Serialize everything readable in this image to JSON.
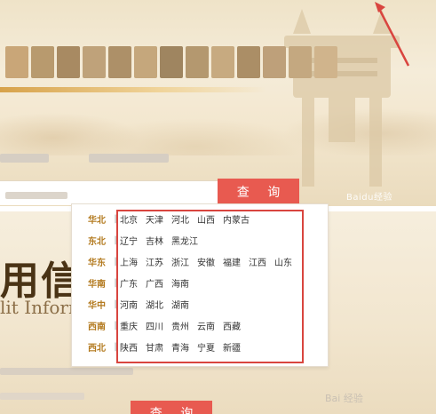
{
  "search": {
    "query_button_label": "查 询"
  },
  "dropdown": {
    "regions": [
      {
        "name": "华北",
        "provinces": [
          "北京",
          "天津",
          "河北",
          "山西",
          "内蒙古"
        ]
      },
      {
        "name": "东北",
        "provinces": [
          "辽宁",
          "吉林",
          "黑龙江"
        ]
      },
      {
        "name": "华东",
        "provinces": [
          "上海",
          "江苏",
          "浙江",
          "安徽",
          "福建",
          "江西",
          "山东"
        ]
      },
      {
        "name": "华南",
        "provinces": [
          "广东",
          "广西",
          "海南"
        ]
      },
      {
        "name": "华中",
        "provinces": [
          "河南",
          "湖北",
          "湖南"
        ]
      },
      {
        "name": "西南",
        "provinces": [
          "重庆",
          "四川",
          "贵州",
          "云南",
          "西藏"
        ]
      },
      {
        "name": "西北",
        "provinces": [
          "陕西",
          "甘肃",
          "青海",
          "宁夏",
          "新疆"
        ]
      }
    ],
    "separator": "|"
  },
  "background": {
    "title_fragment": "用信",
    "subtitle_fragment": "lit Inform",
    "watermark_top": "Baidu经验",
    "watermark_bottom": "Bai 经验",
    "bottom_button_label": "查 询"
  },
  "colors": {
    "accent_red": "#e85a50",
    "highlight_red": "#d9453f",
    "region_label": "#b37a1f"
  }
}
